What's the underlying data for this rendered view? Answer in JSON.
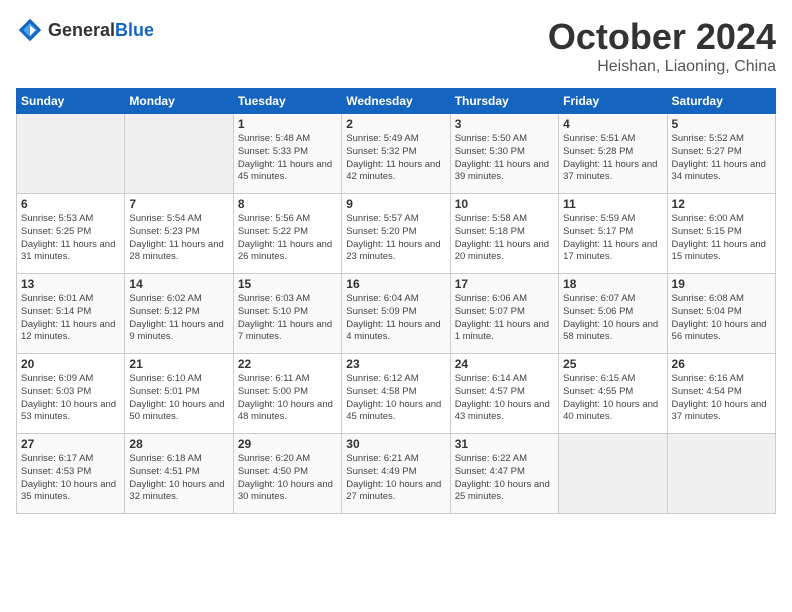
{
  "header": {
    "logo_general": "General",
    "logo_blue": "Blue",
    "month": "October 2024",
    "location": "Heishan, Liaoning, China"
  },
  "weekdays": [
    "Sunday",
    "Monday",
    "Tuesday",
    "Wednesday",
    "Thursday",
    "Friday",
    "Saturday"
  ],
  "weeks": [
    [
      {
        "day": "",
        "empty": true
      },
      {
        "day": "",
        "empty": true
      },
      {
        "day": "1",
        "sunrise": "Sunrise: 5:48 AM",
        "sunset": "Sunset: 5:33 PM",
        "daylight": "Daylight: 11 hours and 45 minutes."
      },
      {
        "day": "2",
        "sunrise": "Sunrise: 5:49 AM",
        "sunset": "Sunset: 5:32 PM",
        "daylight": "Daylight: 11 hours and 42 minutes."
      },
      {
        "day": "3",
        "sunrise": "Sunrise: 5:50 AM",
        "sunset": "Sunset: 5:30 PM",
        "daylight": "Daylight: 11 hours and 39 minutes."
      },
      {
        "day": "4",
        "sunrise": "Sunrise: 5:51 AM",
        "sunset": "Sunset: 5:28 PM",
        "daylight": "Daylight: 11 hours and 37 minutes."
      },
      {
        "day": "5",
        "sunrise": "Sunrise: 5:52 AM",
        "sunset": "Sunset: 5:27 PM",
        "daylight": "Daylight: 11 hours and 34 minutes."
      }
    ],
    [
      {
        "day": "6",
        "sunrise": "Sunrise: 5:53 AM",
        "sunset": "Sunset: 5:25 PM",
        "daylight": "Daylight: 11 hours and 31 minutes."
      },
      {
        "day": "7",
        "sunrise": "Sunrise: 5:54 AM",
        "sunset": "Sunset: 5:23 PM",
        "daylight": "Daylight: 11 hours and 28 minutes."
      },
      {
        "day": "8",
        "sunrise": "Sunrise: 5:56 AM",
        "sunset": "Sunset: 5:22 PM",
        "daylight": "Daylight: 11 hours and 26 minutes."
      },
      {
        "day": "9",
        "sunrise": "Sunrise: 5:57 AM",
        "sunset": "Sunset: 5:20 PM",
        "daylight": "Daylight: 11 hours and 23 minutes."
      },
      {
        "day": "10",
        "sunrise": "Sunrise: 5:58 AM",
        "sunset": "Sunset: 5:18 PM",
        "daylight": "Daylight: 11 hours and 20 minutes."
      },
      {
        "day": "11",
        "sunrise": "Sunrise: 5:59 AM",
        "sunset": "Sunset: 5:17 PM",
        "daylight": "Daylight: 11 hours and 17 minutes."
      },
      {
        "day": "12",
        "sunrise": "Sunrise: 6:00 AM",
        "sunset": "Sunset: 5:15 PM",
        "daylight": "Daylight: 11 hours and 15 minutes."
      }
    ],
    [
      {
        "day": "13",
        "sunrise": "Sunrise: 6:01 AM",
        "sunset": "Sunset: 5:14 PM",
        "daylight": "Daylight: 11 hours and 12 minutes."
      },
      {
        "day": "14",
        "sunrise": "Sunrise: 6:02 AM",
        "sunset": "Sunset: 5:12 PM",
        "daylight": "Daylight: 11 hours and 9 minutes."
      },
      {
        "day": "15",
        "sunrise": "Sunrise: 6:03 AM",
        "sunset": "Sunset: 5:10 PM",
        "daylight": "Daylight: 11 hours and 7 minutes."
      },
      {
        "day": "16",
        "sunrise": "Sunrise: 6:04 AM",
        "sunset": "Sunset: 5:09 PM",
        "daylight": "Daylight: 11 hours and 4 minutes."
      },
      {
        "day": "17",
        "sunrise": "Sunrise: 6:06 AM",
        "sunset": "Sunset: 5:07 PM",
        "daylight": "Daylight: 11 hours and 1 minute."
      },
      {
        "day": "18",
        "sunrise": "Sunrise: 6:07 AM",
        "sunset": "Sunset: 5:06 PM",
        "daylight": "Daylight: 10 hours and 58 minutes."
      },
      {
        "day": "19",
        "sunrise": "Sunrise: 6:08 AM",
        "sunset": "Sunset: 5:04 PM",
        "daylight": "Daylight: 10 hours and 56 minutes."
      }
    ],
    [
      {
        "day": "20",
        "sunrise": "Sunrise: 6:09 AM",
        "sunset": "Sunset: 5:03 PM",
        "daylight": "Daylight: 10 hours and 53 minutes."
      },
      {
        "day": "21",
        "sunrise": "Sunrise: 6:10 AM",
        "sunset": "Sunset: 5:01 PM",
        "daylight": "Daylight: 10 hours and 50 minutes."
      },
      {
        "day": "22",
        "sunrise": "Sunrise: 6:11 AM",
        "sunset": "Sunset: 5:00 PM",
        "daylight": "Daylight: 10 hours and 48 minutes."
      },
      {
        "day": "23",
        "sunrise": "Sunrise: 6:12 AM",
        "sunset": "Sunset: 4:58 PM",
        "daylight": "Daylight: 10 hours and 45 minutes."
      },
      {
        "day": "24",
        "sunrise": "Sunrise: 6:14 AM",
        "sunset": "Sunset: 4:57 PM",
        "daylight": "Daylight: 10 hours and 43 minutes."
      },
      {
        "day": "25",
        "sunrise": "Sunrise: 6:15 AM",
        "sunset": "Sunset: 4:55 PM",
        "daylight": "Daylight: 10 hours and 40 minutes."
      },
      {
        "day": "26",
        "sunrise": "Sunrise: 6:16 AM",
        "sunset": "Sunset: 4:54 PM",
        "daylight": "Daylight: 10 hours and 37 minutes."
      }
    ],
    [
      {
        "day": "27",
        "sunrise": "Sunrise: 6:17 AM",
        "sunset": "Sunset: 4:53 PM",
        "daylight": "Daylight: 10 hours and 35 minutes."
      },
      {
        "day": "28",
        "sunrise": "Sunrise: 6:18 AM",
        "sunset": "Sunset: 4:51 PM",
        "daylight": "Daylight: 10 hours and 32 minutes."
      },
      {
        "day": "29",
        "sunrise": "Sunrise: 6:20 AM",
        "sunset": "Sunset: 4:50 PM",
        "daylight": "Daylight: 10 hours and 30 minutes."
      },
      {
        "day": "30",
        "sunrise": "Sunrise: 6:21 AM",
        "sunset": "Sunset: 4:49 PM",
        "daylight": "Daylight: 10 hours and 27 minutes."
      },
      {
        "day": "31",
        "sunrise": "Sunrise: 6:22 AM",
        "sunset": "Sunset: 4:47 PM",
        "daylight": "Daylight: 10 hours and 25 minutes."
      },
      {
        "day": "",
        "empty": true
      },
      {
        "day": "",
        "empty": true
      }
    ]
  ]
}
